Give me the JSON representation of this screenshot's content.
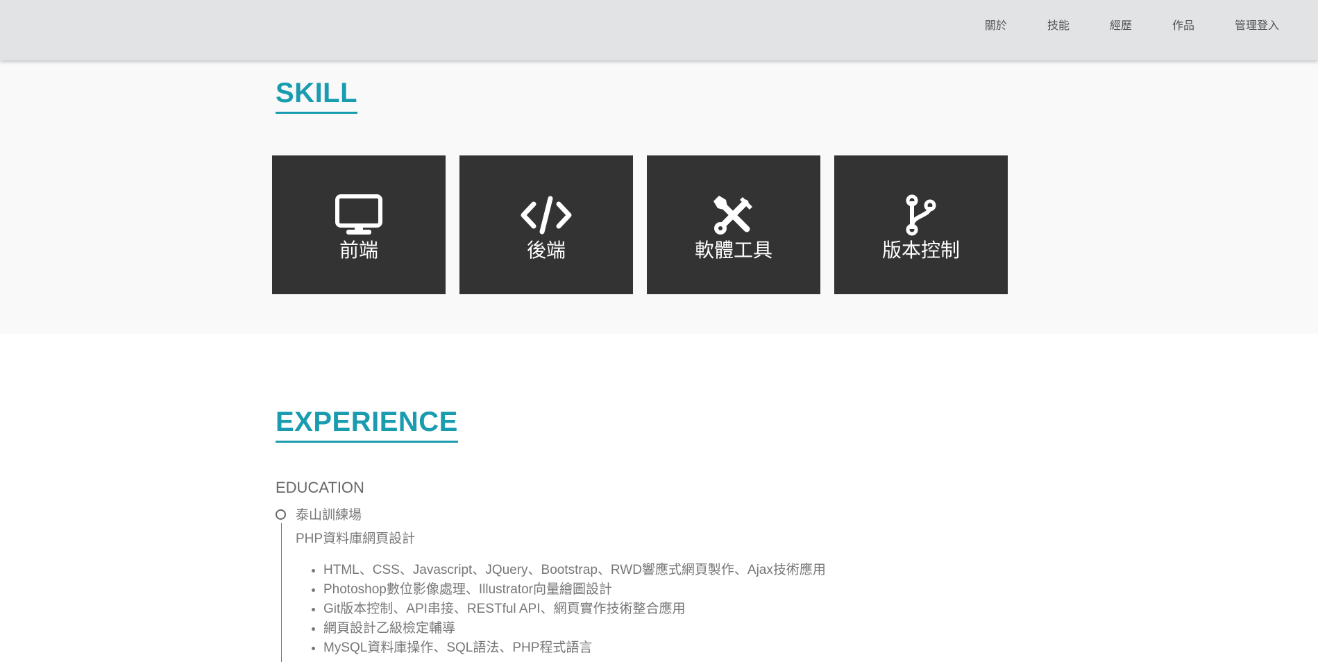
{
  "nav": {
    "items": [
      "關於",
      "技能",
      "經歷",
      "作品",
      "管理登入"
    ]
  },
  "skill": {
    "title": "SKILL",
    "cards": [
      {
        "label": "前端",
        "icon": "monitor-icon"
      },
      {
        "label": "後端",
        "icon": "code-icon"
      },
      {
        "label": "軟體工具",
        "icon": "tools-icon"
      },
      {
        "label": "版本控制",
        "icon": "git-branch-icon"
      }
    ]
  },
  "experience": {
    "title": "EXPERIENCE",
    "education_heading": "EDUCATION",
    "entries": [
      {
        "org": "泰山訓練場",
        "course": "PHP資料庫網頁設計",
        "topics": [
          "HTML、CSS、Javascript、JQuery、Bootstrap、RWD響應式網頁製作、Ajax技術應用",
          "Photoshop數位影像處理、Illustrator向量繪圖設計",
          "Git版本控制、API串接、RESTful API、網頁實作技術整合應用",
          "網頁設計乙級檢定輔導",
          "MySQL資料庫操作、SQL語法、PHP程式語言"
        ]
      }
    ]
  },
  "colors": {
    "accent": "#1a9cb0",
    "navbar_bg": "#e2e3e5",
    "card_bg": "#333333",
    "skill_section_bg": "#f9f9f9"
  }
}
